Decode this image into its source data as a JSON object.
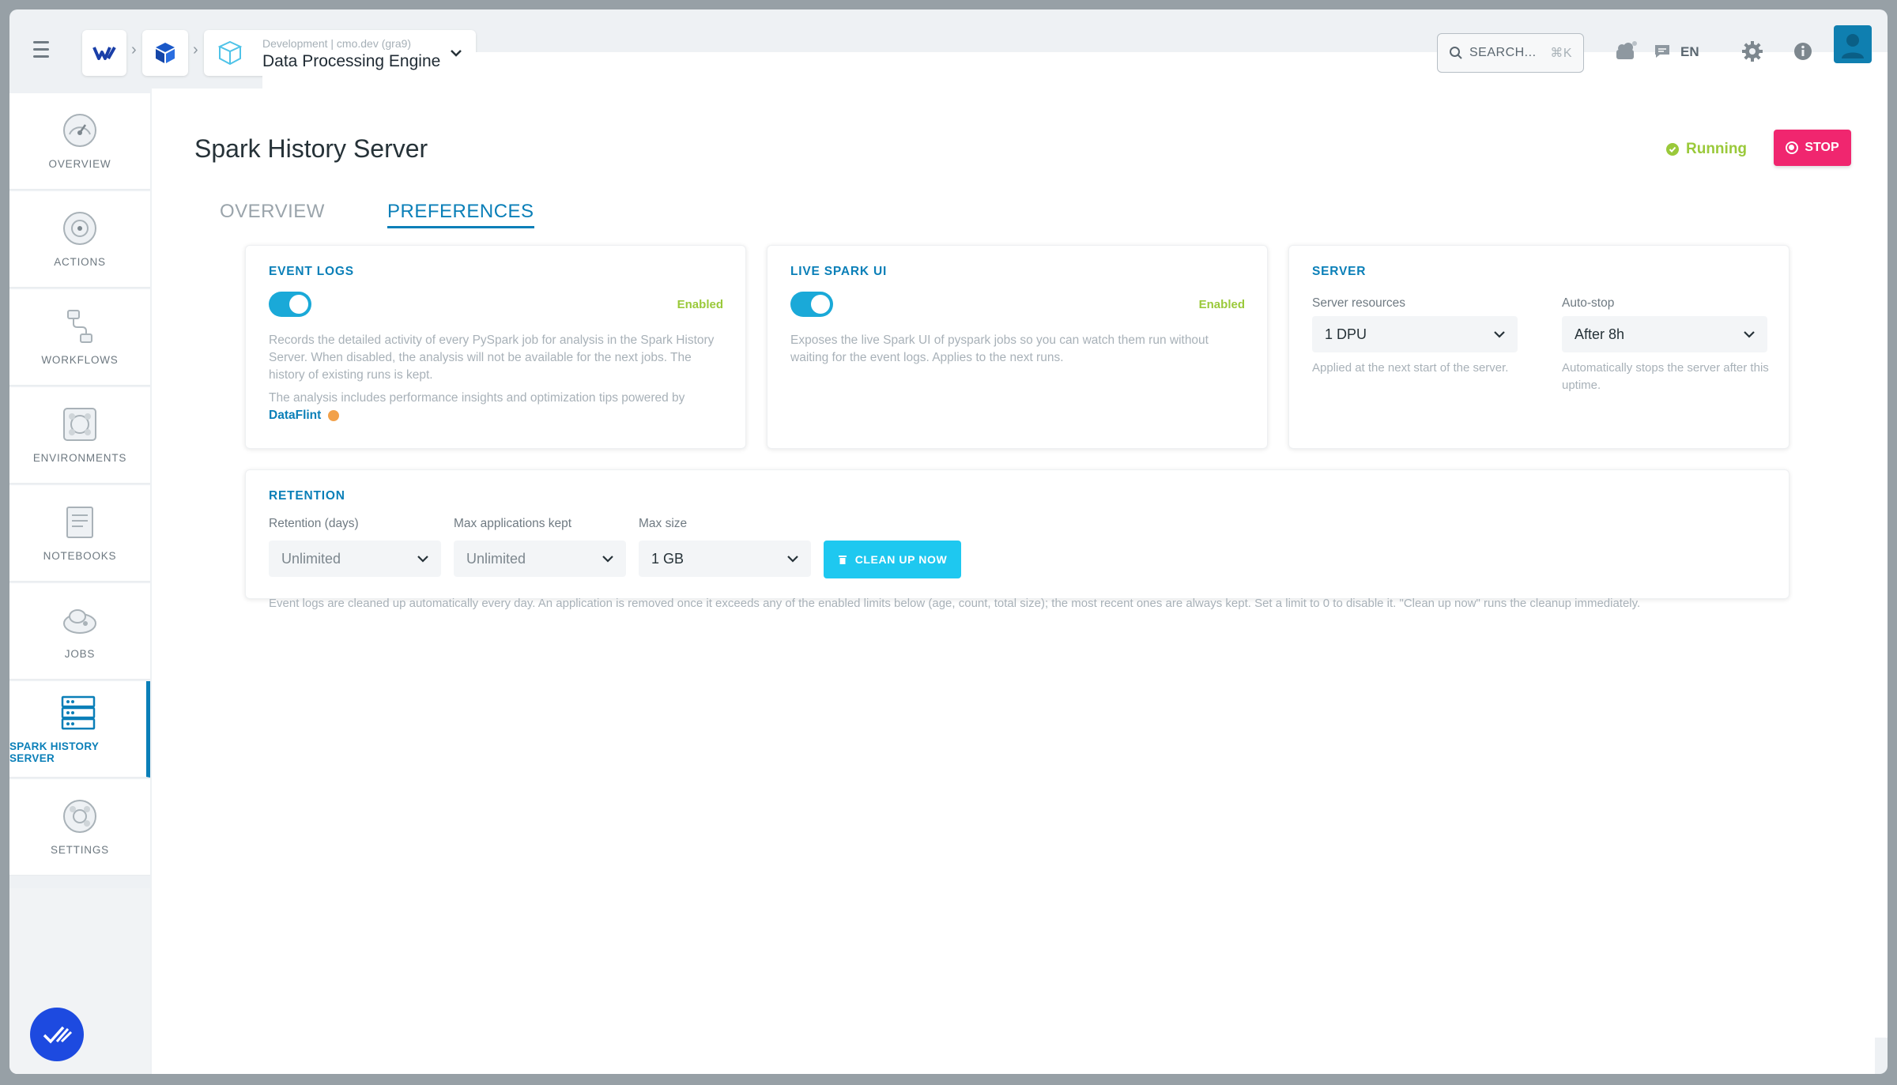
{
  "topbar": {
    "env_subtitle": "Development | cmo.dev (gra9)",
    "env_name": "Data Processing Engine",
    "search_label": "SEARCH...",
    "search_shortcut": "⌘K",
    "language": "EN"
  },
  "sidebar": {
    "items": [
      {
        "label": "OVERVIEW",
        "icon": "speedometer-icon"
      },
      {
        "label": "ACTIONS",
        "icon": "target-icon"
      },
      {
        "label": "WORKFLOWS",
        "icon": "workflow-icon"
      },
      {
        "label": "ENVIRONMENTS",
        "icon": "environment-icon"
      },
      {
        "label": "NOTEBOOKS",
        "icon": "notebook-icon"
      },
      {
        "label": "JOBS",
        "icon": "jobs-icon"
      },
      {
        "label": "SPARK HISTORY SERVER",
        "icon": "server-icon",
        "active": true
      },
      {
        "label": "SETTINGS",
        "icon": "settings-icon"
      }
    ]
  },
  "page": {
    "title": "Spark History Server",
    "status": "Running",
    "stop_label": "STOP",
    "tabs": [
      {
        "label": "OVERVIEW",
        "active": false
      },
      {
        "label": "PREFERENCES",
        "active": true
      }
    ]
  },
  "event_logs": {
    "title": "EVENT LOGS",
    "state": "Enabled",
    "enabled": true,
    "desc1": "Records the detailed activity of every PySpark job for analysis in the Spark History Server. When disabled, the analysis will not be available for the next jobs. The history of existing runs is kept.",
    "desc2": "The analysis includes performance insights and optimization tips powered by",
    "link": "DataFlint"
  },
  "live_spark_ui": {
    "title": "LIVE SPARK UI",
    "state": "Enabled",
    "enabled": true,
    "desc": "Exposes the live Spark UI of pyspark jobs so you can watch them run without waiting for the event logs. Applies to the next runs."
  },
  "server": {
    "title": "SERVER",
    "resources_label": "Server resources",
    "resources_value": "1 DPU",
    "resources_help": "Applied at the next start of the server.",
    "autostop_label": "Auto-stop",
    "autostop_value": "After 8h",
    "autostop_help": "Automatically stops the server after this uptime."
  },
  "retention": {
    "title": "RETENTION",
    "days_label": "Retention (days)",
    "days_value": "Unlimited",
    "max_apps_label": "Max applications kept",
    "max_apps_value": "Unlimited",
    "max_size_label": "Max size",
    "max_size_value": "1 GB",
    "cleanup_label": "CLEAN UP NOW",
    "help": "Event logs are cleaned up automatically every day. An application is removed once it exceeds any of the enabled limits below (age, count, total size); the most recent ones are always kept. Set a limit to 0 to disable it. \"Clean up now\" runs the cleanup immediately."
  },
  "colors": {
    "accent": "#0a7fb8",
    "toggle": "#1aa9d8",
    "running": "#9ac93a",
    "stop": "#f0266f",
    "cleanup": "#1ec8f0"
  }
}
